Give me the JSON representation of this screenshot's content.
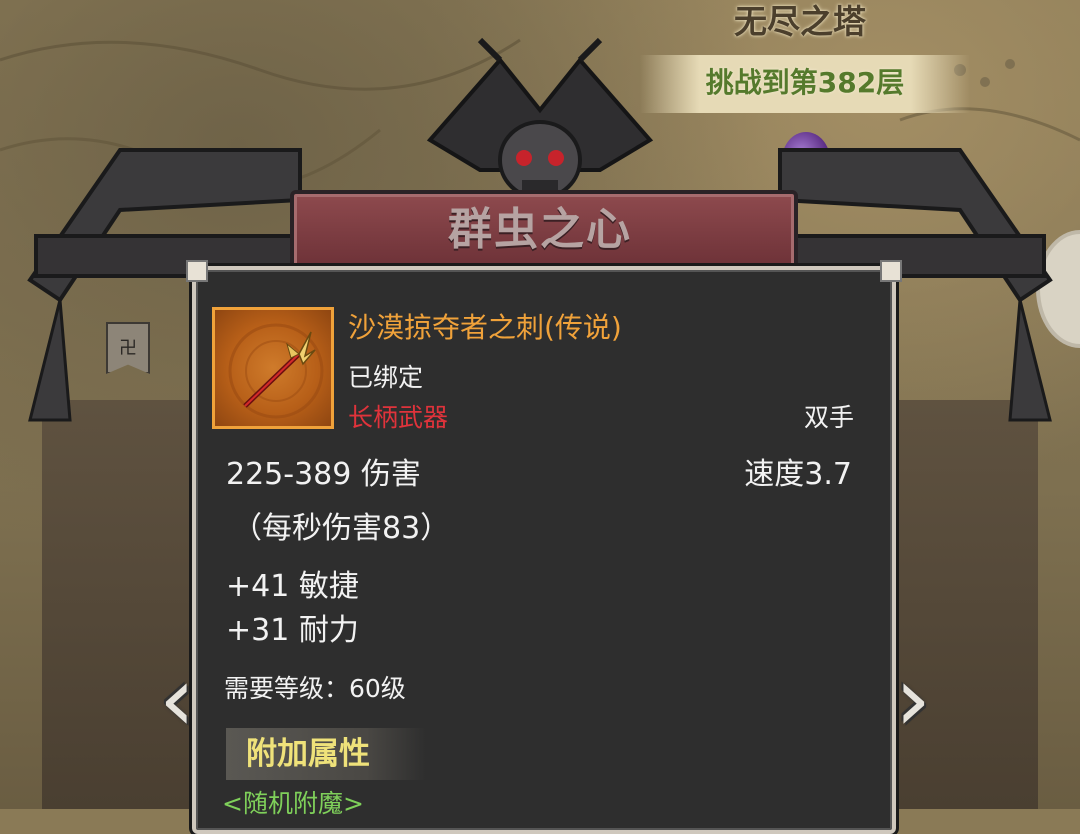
{
  "tower": {
    "title": "无尽之塔",
    "progress": "挑战到第382层"
  },
  "boss": {
    "name": "群虫之心"
  },
  "item": {
    "name": "沙漠掠夺者之刺(传说)",
    "bound": "已绑定",
    "type": "长柄武器",
    "hand": "双手",
    "damage": "225-389 伤害",
    "speed": "速度3.7",
    "dps": "（每秒伤害83）",
    "agility": "+41 敏捷",
    "stamina": "+31 耐力",
    "required_level": "需要等级：60级",
    "extra_section": "附加属性",
    "random_enchant": "<随机附魔>",
    "rarity_color": "#f0a23a",
    "type_color": "#e0333b"
  },
  "icons": {
    "left_arrow": "‹",
    "right_arrow": "›",
    "banner": "卍"
  }
}
